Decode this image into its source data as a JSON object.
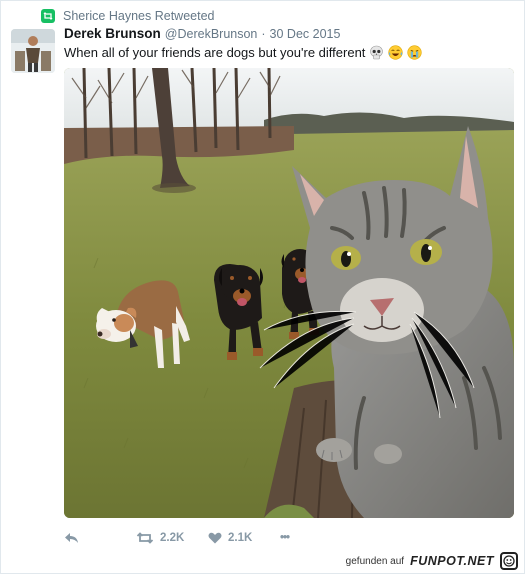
{
  "retweet": {
    "icon": "retweet-badge-icon",
    "text": "Sherice Haynes Retweeted"
  },
  "tweet": {
    "author": {
      "name": "Derek Brunson",
      "handle": "@DerekBrunson",
      "separator": "·",
      "date": "30 Dec 2015",
      "avatar": "avatar-photo"
    },
    "text": "When all of your friends are dogs but you're different",
    "emojis": [
      "skull-emoji",
      "tears-of-joy-emoji",
      "crying-face-emoji"
    ],
    "photo": "cat-selfie-with-three-dogs-photo"
  },
  "actions": {
    "reply": {
      "icon": "reply-icon"
    },
    "retweet": {
      "icon": "retweet-icon",
      "count": "2.2K"
    },
    "like": {
      "icon": "heart-icon",
      "count": "2.1K"
    },
    "more": {
      "icon": "more-icon",
      "label": "•••"
    }
  },
  "footer": {
    "prefix": "gefunden auf",
    "brand": "FUNPOT.NET",
    "logo": "funpot-logo-icon"
  },
  "colors": {
    "retweet_green": "#17bf63",
    "meta_gray": "#657786",
    "action_gray": "#8899a6",
    "text": "#14171a"
  }
}
